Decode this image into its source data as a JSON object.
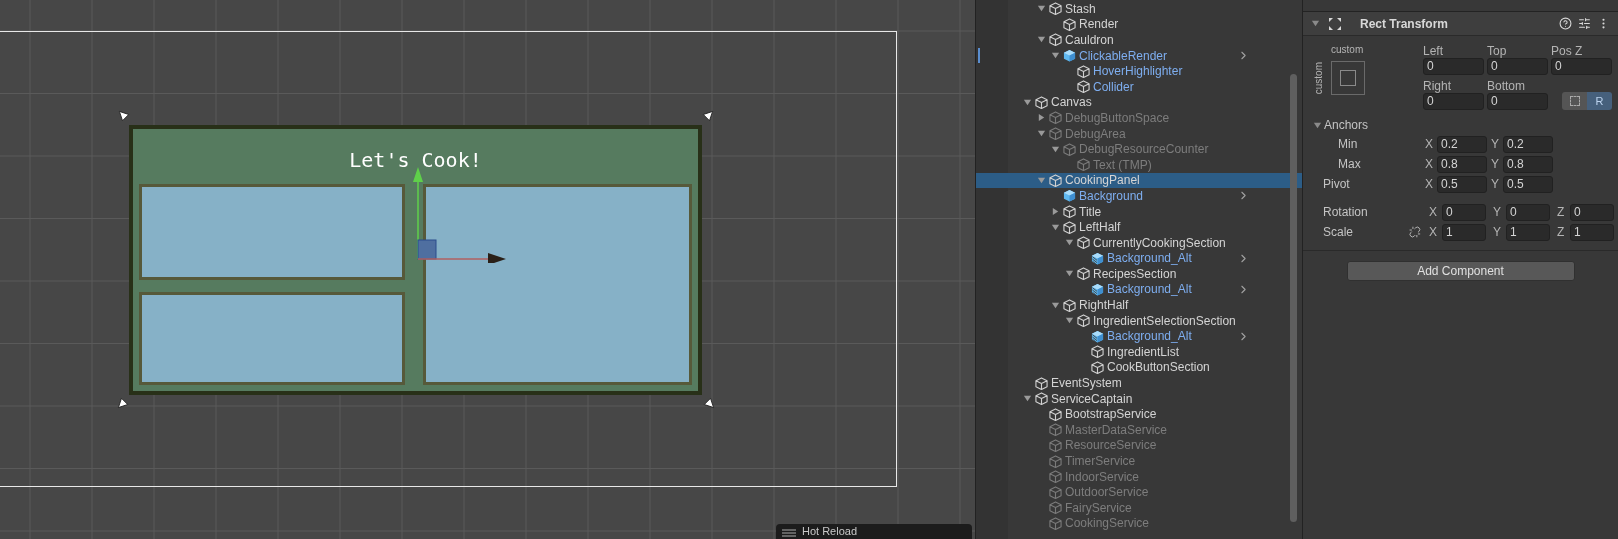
{
  "scene": {
    "panel": {
      "title": "Let's Cook!"
    }
  },
  "hot_reload": {
    "label": "Hot Reload"
  },
  "hierarchy": {
    "items": [
      {
        "children": [
          {
            "name": "Stash",
            "kind": "object",
            "prefab": false,
            "active": true,
            "expanded": true,
            "selected": false,
            "modified": false,
            "chevron": false,
            "children": [
              {
                "name": "Render",
                "kind": "object",
                "prefab": false,
                "active": true,
                "selected": false,
                "modified": false,
                "chevron": false
              }
            ]
          },
          {
            "name": "Cauldron",
            "kind": "object",
            "prefab": false,
            "active": true,
            "expanded": true,
            "selected": false,
            "modified": false,
            "chevron": false,
            "children": [
              {
                "name": "ClickableRender",
                "kind": "prefab",
                "prefab": true,
                "active": true,
                "expanded": true,
                "selected": false,
                "modified": true,
                "chevron": true,
                "children": [
                  {
                    "name": "HoverHighlighter",
                    "kind": "object",
                    "prefab": true,
                    "active": true,
                    "selected": false,
                    "modified": false,
                    "chevron": false
                  },
                  {
                    "name": "Collider",
                    "kind": "object",
                    "prefab": true,
                    "active": true,
                    "selected": false,
                    "modified": false,
                    "chevron": false
                  }
                ]
              }
            ]
          }
        ]
      },
      {
        "name": "Canvas",
        "kind": "object",
        "prefab": false,
        "active": true,
        "expanded": true,
        "selected": false,
        "modified": false,
        "chevron": false,
        "children": [
          {
            "name": "DebugButtonSpace",
            "kind": "object",
            "prefab": false,
            "active": false,
            "expanded": false,
            "selected": false,
            "modified": false,
            "chevron": false
          },
          {
            "name": "DebugArea",
            "kind": "object",
            "prefab": false,
            "active": false,
            "expanded": true,
            "selected": false,
            "modified": false,
            "chevron": false,
            "children": [
              {
                "name": "DebugResourceCounter",
                "kind": "object",
                "prefab": false,
                "active": false,
                "expanded": true,
                "selected": false,
                "modified": false,
                "chevron": false,
                "children": [
                  {
                    "name": "Text (TMP)",
                    "kind": "object",
                    "prefab": false,
                    "active": false,
                    "selected": false,
                    "modified": false,
                    "chevron": false
                  }
                ]
              }
            ]
          },
          {
            "name": "CookingPanel",
            "kind": "object",
            "prefab": false,
            "active": true,
            "expanded": true,
            "selected": true,
            "modified": false,
            "chevron": false,
            "children": [
              {
                "name": "Background",
                "kind": "prefab",
                "prefab": true,
                "active": true,
                "selected": false,
                "modified": false,
                "chevron": true
              },
              {
                "name": "Title",
                "kind": "object",
                "prefab": false,
                "active": true,
                "expanded": false,
                "selected": false,
                "modified": false,
                "chevron": false
              },
              {
                "name": "LeftHalf",
                "kind": "object",
                "prefab": false,
                "active": true,
                "expanded": true,
                "selected": false,
                "modified": false,
                "chevron": false,
                "children": [
                  {
                    "name": "CurrentlyCookingSection",
                    "kind": "object",
                    "prefab": false,
                    "active": true,
                    "expanded": true,
                    "selected": false,
                    "modified": false,
                    "chevron": false,
                    "children": [
                      {
                        "name": "Background_Alt",
                        "kind": "variant",
                        "prefab": true,
                        "active": true,
                        "selected": false,
                        "modified": false,
                        "chevron": true
                      }
                    ]
                  },
                  {
                    "name": "RecipesSection",
                    "kind": "object",
                    "prefab": false,
                    "active": true,
                    "expanded": true,
                    "selected": false,
                    "modified": false,
                    "chevron": false,
                    "children": [
                      {
                        "name": "Background_Alt",
                        "kind": "variant",
                        "prefab": true,
                        "active": true,
                        "selected": false,
                        "modified": false,
                        "chevron": true
                      }
                    ]
                  }
                ]
              },
              {
                "name": "RightHalf",
                "kind": "object",
                "prefab": false,
                "active": true,
                "expanded": true,
                "selected": false,
                "modified": false,
                "chevron": false,
                "children": [
                  {
                    "name": "IngredientSelectionSection",
                    "kind": "object",
                    "prefab": false,
                    "active": true,
                    "expanded": true,
                    "selected": false,
                    "modified": false,
                    "chevron": false,
                    "children": [
                      {
                        "name": "Background_Alt",
                        "kind": "variant",
                        "prefab": true,
                        "active": true,
                        "selected": false,
                        "modified": false,
                        "chevron": true
                      },
                      {
                        "name": "IngredientList",
                        "kind": "object",
                        "prefab": false,
                        "active": true,
                        "selected": false,
                        "modified": false,
                        "chevron": false
                      },
                      {
                        "name": "CookButtonSection",
                        "kind": "object",
                        "prefab": false,
                        "active": true,
                        "selected": false,
                        "modified": false,
                        "chevron": false
                      }
                    ]
                  }
                ]
              }
            ]
          }
        ]
      },
      {
        "name": "EventSystem",
        "kind": "object",
        "prefab": false,
        "active": true,
        "selected": false,
        "modified": false,
        "chevron": false
      },
      {
        "name": "ServiceCaptain",
        "kind": "object",
        "prefab": false,
        "active": true,
        "expanded": true,
        "selected": false,
        "modified": false,
        "chevron": false,
        "children": [
          {
            "name": "BootstrapService",
            "kind": "object",
            "prefab": false,
            "active": true,
            "selected": false,
            "modified": false,
            "chevron": false
          },
          {
            "name": "MasterDataService",
            "kind": "object",
            "prefab": false,
            "active": false,
            "selected": false,
            "modified": false,
            "chevron": false
          },
          {
            "name": "ResourceService",
            "kind": "object",
            "prefab": false,
            "active": false,
            "selected": false,
            "modified": false,
            "chevron": false
          },
          {
            "name": "TimerService",
            "kind": "object",
            "prefab": false,
            "active": false,
            "selected": false,
            "modified": false,
            "chevron": false
          },
          {
            "name": "IndoorService",
            "kind": "object",
            "prefab": false,
            "active": false,
            "selected": false,
            "modified": false,
            "chevron": false
          },
          {
            "name": "OutdoorService",
            "kind": "object",
            "prefab": false,
            "active": false,
            "selected": false,
            "modified": false,
            "chevron": false
          },
          {
            "name": "FairyService",
            "kind": "object",
            "prefab": false,
            "active": false,
            "selected": false,
            "modified": false,
            "chevron": false
          },
          {
            "name": "CookingService",
            "kind": "object",
            "prefab": false,
            "active": false,
            "selected": false,
            "modified": false,
            "chevron": false
          }
        ]
      }
    ]
  },
  "inspector": {
    "component": {
      "title": "Rect Transform",
      "expanded": true
    },
    "anchor_preset": {
      "top_label": "custom",
      "side_label": "custom"
    },
    "position_fields": [
      {
        "label": "Left",
        "value": "0"
      },
      {
        "label": "Top",
        "value": "0"
      },
      {
        "label": "Pos Z",
        "value": "0"
      },
      {
        "label": "Right",
        "value": "0"
      },
      {
        "label": "Bottom",
        "value": "0"
      }
    ],
    "mode_buttons": [
      {
        "kind": "blueprint",
        "selected": false
      },
      {
        "kind": "raw",
        "label": "R",
        "selected": true
      }
    ],
    "anchors": {
      "label": "Anchors",
      "expanded": true,
      "rows": [
        {
          "label": "Min",
          "fields": [
            {
              "axis": "X",
              "value": "0.2"
            },
            {
              "axis": "Y",
              "value": "0.2"
            }
          ]
        },
        {
          "label": "Max",
          "fields": [
            {
              "axis": "X",
              "value": "0.8"
            },
            {
              "axis": "Y",
              "value": "0.8"
            }
          ]
        }
      ]
    },
    "pivot": {
      "label": "Pivot",
      "fields": [
        {
          "axis": "X",
          "value": "0.5"
        },
        {
          "axis": "Y",
          "value": "0.5"
        }
      ]
    },
    "rotation": {
      "label": "Rotation",
      "fields": [
        {
          "axis": "X",
          "value": "0"
        },
        {
          "axis": "Y",
          "value": "0"
        },
        {
          "axis": "Z",
          "value": "0"
        }
      ]
    },
    "scale": {
      "label": "Scale",
      "fields": [
        {
          "axis": "X",
          "value": "1"
        },
        {
          "axis": "Y",
          "value": "1"
        },
        {
          "axis": "Z",
          "value": "1"
        }
      ]
    },
    "add_component": "Add Component"
  }
}
